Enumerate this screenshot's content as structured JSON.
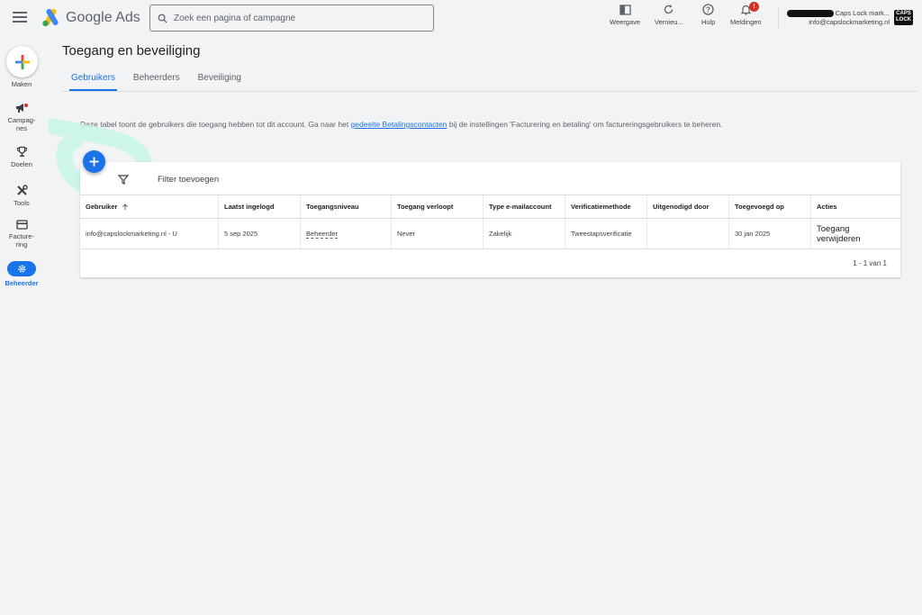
{
  "app": {
    "brand": "Google Ads"
  },
  "search": {
    "placeholder": "Zoek een pagina of campagne"
  },
  "toolbar": [
    {
      "label": "Weergave",
      "icon": "view-icon"
    },
    {
      "label": "Vernieu...",
      "icon": "refresh-icon"
    },
    {
      "label": "Hulp",
      "icon": "help-icon"
    },
    {
      "label": "Meldingen",
      "icon": "bell-icon",
      "badge": "!"
    }
  ],
  "account": {
    "name": "Caps Lock mark...",
    "email": "info@capslockmarketing.nl",
    "logo_text": "CAPS LOCK"
  },
  "rail": {
    "create": "Maken",
    "items": [
      {
        "label": "Campag-\nnes",
        "icon": "megaphone-icon"
      },
      {
        "label": "Doelen",
        "icon": "trophy-icon"
      },
      {
        "label": "Tools",
        "icon": "tools-icon"
      },
      {
        "label": "Facture-\nring",
        "icon": "billing-icon"
      },
      {
        "label": "Beheerder",
        "icon": "gear-icon",
        "active": true
      }
    ]
  },
  "page": {
    "title": "Toegang en beveiliging",
    "tabs": [
      "Gebruikers",
      "Beheerders",
      "Beveiliging"
    ],
    "active_tab": 0,
    "info_before": "Deze tabel toont de gebruikers die toegang hebben tot dit account. Ga naar het ",
    "info_link": "gedeelte Betalingscontacten",
    "info_after": " bij de instellingen 'Facturering en betaling' om factureringsgebruikers te beheren."
  },
  "table": {
    "filter_label": "Filter toevoegen",
    "columns": [
      "Gebruiker",
      "Laatst ingelogd",
      "Toegangsniveau",
      "Toegang verloopt",
      "Type e-mailaccount",
      "Verificatiemethode",
      "Uitgenodigd door",
      "Toegevoegd op",
      "Acties"
    ],
    "rows": [
      {
        "user": "info@capslockmarketing.nl - U",
        "last_login": "5 sep 2025",
        "access_level": "Beheerder",
        "expires": "Never",
        "email_type": "Zakelijk",
        "verification": "Tweestapsverificatie",
        "invited_by": "",
        "added_on": "30 jan 2025",
        "action": "Toegang verwijderen"
      }
    ],
    "pagination": "1 - 1 van 1"
  },
  "colors": {
    "accent": "#1a73e8",
    "highlight": "#c8f5e8",
    "background": "#f1f3f4"
  }
}
